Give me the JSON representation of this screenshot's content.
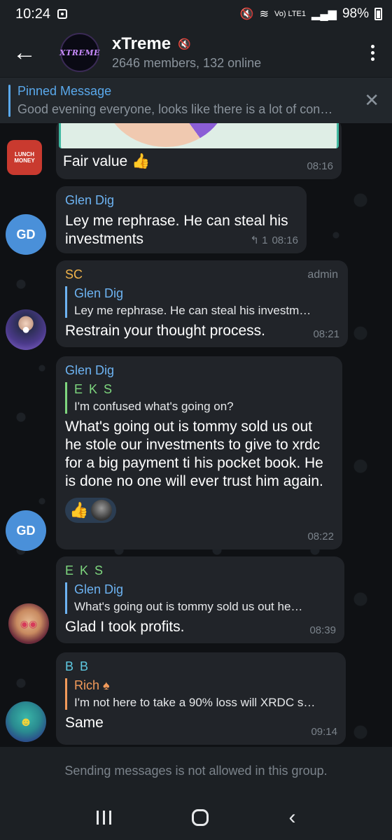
{
  "status_bar": {
    "time": "10:24",
    "network": "Vo) LTE1",
    "battery": "98%"
  },
  "header": {
    "back_icon": "arrow-left-icon",
    "avatar_text": "XTREME",
    "title": "xTreme",
    "subtitle": "2646 members, 132 online"
  },
  "pinned": {
    "title": "Pinned Message",
    "text": "Good evening everyone, looks like there is a lot of con…"
  },
  "messages": [
    {
      "text": "Fair value 👍",
      "time": "08:16"
    },
    {
      "sender": "Glen Dig",
      "sender_color": "#6db3f2",
      "avatar_initials": "GD",
      "text": "Ley me rephrase.  He can steal his investments",
      "reply_count": "↰ 1",
      "time": "08:16"
    },
    {
      "sender": "SC",
      "sender_color": "#f0b34b",
      "badge": "admin",
      "reply_name": "Glen Dig",
      "reply_text": "Ley me rephrase.  He can steal his investm…",
      "text": "Restrain your thought process.",
      "time": "08:21"
    },
    {
      "sender": "Glen Dig",
      "sender_color": "#6db3f2",
      "avatar_initials": "GD",
      "reply_name": "E K S",
      "reply_text": "I'm confused what's going on?",
      "text": "What's going out is tommy sold us out he stole our investments to give to xrdc for a big payment ti his pocket book. He is done no one will ever trust him again.",
      "reaction": "👍",
      "time": "08:22"
    },
    {
      "sender": "E K S",
      "sender_color": "#7ed67e",
      "reply_name": "Glen Dig",
      "reply_text": "What's going out is tommy sold us out   he…",
      "text": "Glad I took profits.",
      "time": "08:39"
    },
    {
      "sender": "B B",
      "sender_color": "#5ec8e0",
      "reply_name": "Rich ♠",
      "reply_text": "I'm not here to take a 90% loss will XRDC s…",
      "text": "Same",
      "time": "09:14"
    }
  ],
  "footer": {
    "notice": "Sending messages is not allowed in this group."
  },
  "colors": {
    "accent": "#5aa9ec",
    "bubble": "#212429",
    "header": "#1c2024"
  }
}
